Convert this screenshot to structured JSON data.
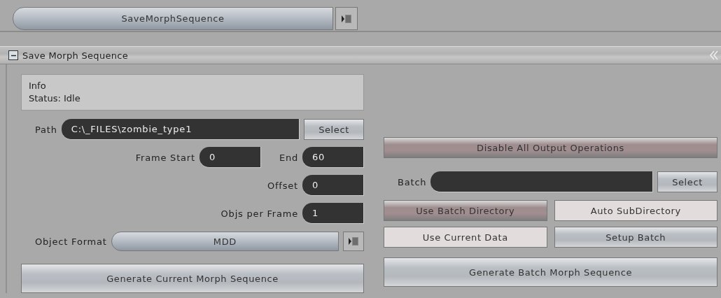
{
  "toolbar": {
    "dropdown": "SaveMorphSequence"
  },
  "panel": {
    "title": "Save Morph Sequence",
    "expanded": true
  },
  "info": {
    "title": "Info",
    "status": "Status: Idle"
  },
  "path": {
    "label": "Path",
    "value": "C:\\_FILES\\zombie_type1",
    "button": "Select"
  },
  "frame_start": {
    "label": "Frame Start",
    "value": "0"
  },
  "frame_end": {
    "label": "End",
    "value": "60"
  },
  "offset": {
    "label": "Offset",
    "value": "0"
  },
  "objs_per_frame": {
    "label": "Objs per Frame",
    "value": "1"
  },
  "object_format": {
    "label": "Object Format",
    "value": "MDD"
  },
  "generate_current": "Generate Current Morph Sequence",
  "disable_output": {
    "label": "Disable All Output Operations",
    "on": false
  },
  "batch": {
    "label": "Batch",
    "button": "Select"
  },
  "toggles": [
    {
      "label": "Use Batch Directory",
      "on": false
    },
    {
      "label": "Auto SubDirectory",
      "on": true
    },
    {
      "label": "Use Current Data",
      "on": true
    }
  ],
  "setup_batch": "Setup Batch",
  "generate_batch": "Generate Batch Morph Sequence"
}
